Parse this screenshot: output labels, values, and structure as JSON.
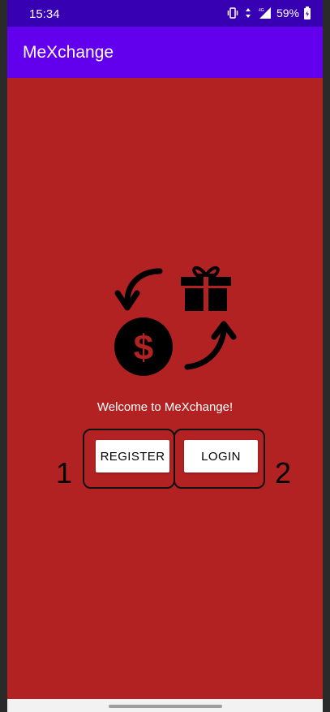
{
  "status_bar": {
    "time": "15:34",
    "battery_text": "59%",
    "icons": [
      "vibrate-icon",
      "data-arrows-icon",
      "signal-4g-icon",
      "battery-icon"
    ]
  },
  "app_bar": {
    "title": "MeXchange"
  },
  "main": {
    "hero_icon": "money-gift-exchange-icon",
    "welcome": "Welcome to MeXchange!",
    "register_label": "REGISTER",
    "login_label": "LOGIN",
    "annotation_1": "1",
    "annotation_2": "2"
  },
  "colors": {
    "status_bar": "#3700B3",
    "app_bar": "#6200EE",
    "background": "#B22222",
    "button": "#FFFFFF"
  }
}
